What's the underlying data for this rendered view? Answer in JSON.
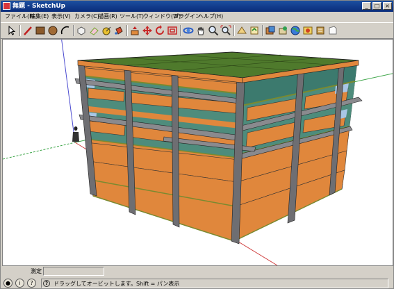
{
  "window": {
    "title": "無題 - SketchUp",
    "minimize_glyph": "_",
    "maximize_glyph": "□",
    "close_glyph": "×"
  },
  "menu": [
    {
      "label": "ファイル(F)"
    },
    {
      "label": "編集(E)"
    },
    {
      "label": "表示(V)"
    },
    {
      "label": "カメラ(C)"
    },
    {
      "label": "描画(R)"
    },
    {
      "label": "ツール(T)"
    },
    {
      "label": "ウィンドウ(W)"
    },
    {
      "label": "プラグイン"
    },
    {
      "label": "ヘルプ(H)"
    }
  ],
  "toolbar": {
    "tools": [
      {
        "icon": "select-icon"
      },
      {
        "icon": "pencil-line-icon"
      },
      {
        "icon": "rectangle-icon"
      },
      {
        "icon": "circle-icon"
      },
      {
        "icon": "arc-icon"
      },
      {
        "icon": "make-component-icon"
      },
      {
        "icon": "eraser-icon"
      },
      {
        "icon": "tape-measure-icon"
      },
      {
        "icon": "paint-bucket-icon"
      },
      {
        "icon": "push-pull-icon"
      },
      {
        "icon": "move-icon"
      },
      {
        "icon": "rotate-icon"
      },
      {
        "icon": "offset-icon"
      },
      {
        "icon": "orbit-icon"
      },
      {
        "icon": "pan-icon"
      },
      {
        "icon": "zoom-icon"
      },
      {
        "icon": "zoom-extents-icon"
      },
      {
        "icon": "3d-warehouse-icon"
      },
      {
        "icon": "share-model-icon"
      },
      {
        "icon": "get-models-icon"
      },
      {
        "icon": "place-model-icon"
      },
      {
        "icon": "google-earth-icon"
      },
      {
        "icon": "photo-textures-icon"
      },
      {
        "icon": "extension-warehouse-icon"
      },
      {
        "icon": "layout-icon"
      }
    ]
  },
  "measurements": {
    "label": "測定",
    "value": ""
  },
  "status": {
    "message": "ドラッグしてオービットします。Shift = パン表示",
    "button1": "●",
    "button2": "i",
    "button3": "?"
  },
  "colors": {
    "facade_orange": "#e0873c",
    "frame_gray": "#6e6e72",
    "roof_green": "#4f7a2c",
    "glass_blue": "#a9c6e6",
    "interior_teal": "#4e8c7c",
    "axis_red": "#d04040",
    "axis_green": "#3fa64a",
    "axis_blue": "#4a4ad0"
  }
}
